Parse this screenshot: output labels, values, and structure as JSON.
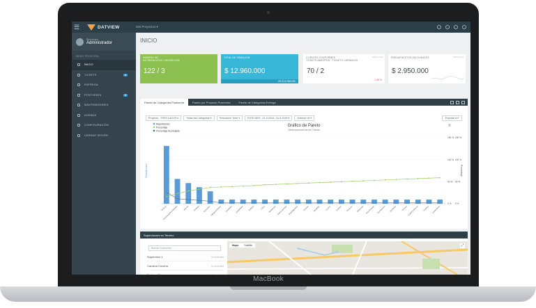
{
  "device_label": "MacBook",
  "app": {
    "logo_text": "DATVIEW",
    "projects_menu": "Mis Proyectos ▾"
  },
  "user": {
    "welcome": "Bienvenido",
    "name": "Administrador"
  },
  "sidebar": {
    "title": "MENU PRINCIPAL",
    "items": [
      {
        "label": "INICIO",
        "icon": "home-icon",
        "active": true
      },
      {
        "label": "TICKETS",
        "icon": "ticket-icon",
        "badge": "8"
      },
      {
        "label": "ENTREGA",
        "icon": "key-icon"
      },
      {
        "label": "POSTVENTA",
        "icon": "wrench-icon",
        "badge": "9"
      },
      {
        "label": "MANTENEDORES",
        "icon": "list-icon"
      },
      {
        "label": "AGENDA",
        "icon": "calendar-icon"
      },
      {
        "label": "CONFIGURACIÓN",
        "icon": "gear-icon"
      },
      {
        "label": "CERRAR SESIÓN",
        "icon": "power-icon"
      }
    ]
  },
  "page_title": "INICIO",
  "kpis": [
    {
      "label": "NÚMERO DE\nNO RESUELTOS / RESUELTOS",
      "value": "122 / 3",
      "color": "#8cc152"
    },
    {
      "label": "TOTAL DE TRABAJOS",
      "value": "$ 12.960.000",
      "footer": "0% $ 12.960.000",
      "color": "#38b7d9"
    },
    {
      "label": "CLIENTES CONFORMES\nTICKETS ABIERTOS / TICKETS CERRADOS",
      "value": "70 / 2",
      "footer": "1.95 %",
      "sub": "Ultimo mes"
    },
    {
      "label": "PRESUPUESTOS ADICIONALES",
      "value": "$ 2.950.000",
      "sub": "Ultimo mes"
    }
  ],
  "chart_tabs": [
    "Pareto de Categorías Postventa",
    "Pareto por Proyecto Postventa",
    "Pareto de Categorías Entrega"
  ],
  "filters": [
    "Proyecto - TRES LAGOS ▾",
    "Todas las Categorías ▾",
    "Seleccione Torre ▾",
    "ESTE MES - 01-3-2018 - 31-3-2018 ▾",
    "Ordenar de ▾"
  ],
  "export_label": "Exportar a ▾",
  "chart_data": {
    "type": "bar",
    "title": "Gráfico de Pareto",
    "subtitle": "Observaciones de los Tickets",
    "ylabel": "Repeticiones",
    "y2label": "Porcentaje",
    "legend": [
      "Repeticiones",
      "Porcentaje",
      "Porcentaje Acumulado"
    ],
    "legend_position": "top-left",
    "y2_ticks": [
      "150 %",
      "100 %",
      "50 %",
      "0 %"
    ],
    "y2_ticks_right": [
      "150 %",
      "100 %",
      "50 %",
      "0 %"
    ],
    "categories": [
      "Pintura",
      "Cerámica/Porcelanato",
      "Muros",
      "Puertas",
      "Enchufes",
      "Tabiques/Cielos",
      "Ventanas",
      "Lavaplatos",
      "Grifería",
      "Otros",
      "Artefactos",
      "Cierre puertas",
      "Guardapolvos",
      "Closets",
      "Muebles",
      "Cocina",
      "Calefón",
      "Terrazas",
      "Molduras",
      "Piso flotante",
      "Iluminación",
      "Ventanas",
      "Ductos",
      "Cubierta Muros",
      "Pasillos",
      "Lavamanos"
    ],
    "values": [
      14,
      6,
      5,
      4,
      3,
      1,
      1,
      1,
      1,
      1,
      1,
      1,
      1,
      1,
      1,
      1,
      1,
      1,
      1,
      1,
      1,
      1,
      1,
      1,
      1,
      1
    ],
    "cumulative_pct": [
      16,
      23,
      29,
      33,
      37,
      38,
      39,
      40,
      41,
      43,
      44,
      45,
      46,
      47,
      48,
      49,
      50,
      51,
      52,
      53,
      54,
      55,
      56,
      57,
      58,
      59
    ],
    "ylim": [
      0,
      16
    ],
    "y2lim": [
      0,
      150
    ],
    "colors": {
      "bars": "#5b9bd5",
      "line": "#9ccc65",
      "pct": "#4a6d8c"
    }
  },
  "supervisors": {
    "title": "Supervisores en Terreno",
    "search_placeholder": "Buscar Supervisor...",
    "list": [
      {
        "name": "Supervisor 1",
        "status": "Sin actividad"
      },
      {
        "name": "Carolina Concha",
        "status": "Sin actividad"
      },
      {
        "name": "Esteban Flores",
        "status": "Sin actividad"
      }
    ],
    "map_tabs": [
      "Mapa",
      "Satélite"
    ]
  }
}
